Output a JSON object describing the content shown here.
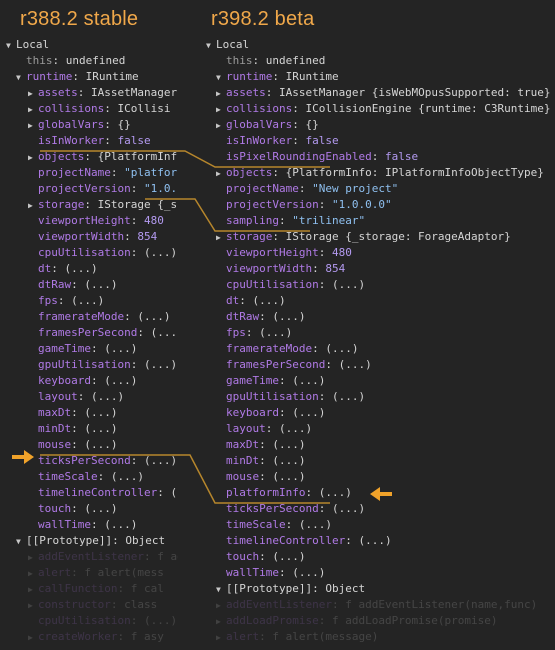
{
  "headers": {
    "stable": "r388.2 stable",
    "beta": "r398.2 beta"
  },
  "colors": {
    "accent": "#f0a84a",
    "background": "#242424"
  },
  "left": {
    "rows": [
      {
        "name": "local",
        "tri": "down",
        "key": "Local",
        "val": "",
        "keyClass": "label"
      },
      {
        "name": "this",
        "tri": "",
        "key": "this",
        "val": "undefined",
        "keyClass": "k dim",
        "valClass": "v-id"
      },
      {
        "name": "runtime",
        "tri": "down",
        "key": "runtime",
        "val": "IRuntime",
        "valClass": "v-id"
      },
      {
        "name": "assets",
        "tri": "right",
        "key": "assets",
        "val": "IAssetManager"
      },
      {
        "name": "collisions",
        "tri": "right",
        "key": "collisions",
        "val": "ICollisi"
      },
      {
        "name": "globalvars",
        "tri": "right",
        "key": "globalVars",
        "val": "{}"
      },
      {
        "name": "isinworker",
        "tri": "",
        "key": "isInWorker",
        "val": "false",
        "valClass": "v-bool"
      },
      {
        "name": "objects",
        "tri": "right",
        "key": "objects",
        "val": "{PlatformInf"
      },
      {
        "name": "projectname",
        "tri": "",
        "key": "projectName",
        "val": "\"platfor",
        "valClass": "v-str"
      },
      {
        "name": "projectversion",
        "tri": "",
        "key": "projectVersion",
        "val": "\"1.0.",
        "valClass": "v-str"
      },
      {
        "name": "storage",
        "tri": "right",
        "key": "storage",
        "val": "IStorage {_s"
      },
      {
        "name": "viewportheight",
        "tri": "",
        "key": "viewportHeight",
        "val": "480",
        "valClass": "v-num"
      },
      {
        "name": "viewportwidth",
        "tri": "",
        "key": "viewportWidth",
        "val": "854",
        "valClass": "v-num"
      },
      {
        "name": "cpuutilisation",
        "tri": "",
        "key": "cpuUtilisation",
        "val": "(...)"
      },
      {
        "name": "dt",
        "tri": "",
        "key": "dt",
        "val": "(...)"
      },
      {
        "name": "dtraw",
        "tri": "",
        "key": "dtRaw",
        "val": "(...)"
      },
      {
        "name": "fps",
        "tri": "",
        "key": "fps",
        "val": "(...)"
      },
      {
        "name": "frameratemode",
        "tri": "",
        "key": "framerateMode",
        "val": "(...)"
      },
      {
        "name": "framespersecond",
        "tri": "",
        "key": "framesPerSecond",
        "val": "(...)"
      },
      {
        "name": "gametime",
        "tri": "",
        "key": "gameTime",
        "val": "(...)"
      },
      {
        "name": "gpuutilisation",
        "tri": "",
        "key": "gpuUtilisation",
        "val": "(...)"
      },
      {
        "name": "keyboard",
        "tri": "",
        "key": "keyboard",
        "val": "(...)"
      },
      {
        "name": "layout",
        "tri": "",
        "key": "layout",
        "val": "(...)"
      },
      {
        "name": "maxdt",
        "tri": "",
        "key": "maxDt",
        "val": "(...)"
      },
      {
        "name": "mindt",
        "tri": "",
        "key": "minDt",
        "val": "(...)"
      },
      {
        "name": "mouse",
        "tri": "",
        "key": "mouse",
        "val": "(...)"
      },
      {
        "name": "tickspersecond",
        "tri": "",
        "key": "ticksPerSecond",
        "val": "(...)"
      },
      {
        "name": "timescale",
        "tri": "",
        "key": "timeScale",
        "val": "(...)"
      },
      {
        "name": "timelinecontroller",
        "tri": "",
        "key": "timelineController",
        "val": "("
      },
      {
        "name": "touch",
        "tri": "",
        "key": "touch",
        "val": "(...)"
      },
      {
        "name": "walltime",
        "tri": "",
        "key": "wallTime",
        "val": "(...)"
      },
      {
        "name": "prototype",
        "tri": "down",
        "key": "[[Prototype]]",
        "val": "Object",
        "keyClass": "label",
        "valClass": "v-id"
      },
      {
        "name": "proto-a",
        "tri": "right",
        "key": "addEventListener",
        "val": "f addEve",
        "faded": true
      },
      {
        "name": "proto-b",
        "tri": "right",
        "key": "alert",
        "val": "f alert(mess",
        "faded": true
      },
      {
        "name": "proto-c",
        "tri": "right",
        "key": "callFunction",
        "val": "f cal",
        "faded": true
      },
      {
        "name": "proto-d",
        "tri": "right",
        "key": "constructor",
        "val": "class",
        "faded": true
      },
      {
        "name": "proto-e",
        "tri": "",
        "key": "cpuUtilisation",
        "val": "(...)",
        "faded": true
      },
      {
        "name": "proto-f",
        "tri": "right",
        "key": "createWorker",
        "val": "f asy",
        "faded": true
      }
    ]
  },
  "right": {
    "rows": [
      {
        "name": "local",
        "tri": "down",
        "key": "Local",
        "val": "",
        "keyClass": "label"
      },
      {
        "name": "this",
        "tri": "",
        "key": "this",
        "val": "undefined",
        "keyClass": "k dim",
        "valClass": "v-id"
      },
      {
        "name": "runtime",
        "tri": "down",
        "key": "runtime",
        "val": "IRuntime",
        "valClass": "v-id"
      },
      {
        "name": "assets",
        "tri": "right",
        "key": "assets",
        "val": "IAssetManager {isWebMOpusSupported: true}"
      },
      {
        "name": "collisions",
        "tri": "right",
        "key": "collisions",
        "val": "ICollisionEngine {runtime: C3Runtime}"
      },
      {
        "name": "globalvars",
        "tri": "right",
        "key": "globalVars",
        "val": "{}"
      },
      {
        "name": "isinworker",
        "tri": "",
        "key": "isInWorker",
        "val": "false",
        "valClass": "v-bool"
      },
      {
        "name": "ispixelroundingenabled",
        "tri": "",
        "key": "isPixelRoundingEnabled",
        "val": "false",
        "valClass": "v-bool"
      },
      {
        "name": "objects",
        "tri": "right",
        "key": "objects",
        "val": "{PlatformInfo: IPlatformInfoObjectType}"
      },
      {
        "name": "projectname",
        "tri": "",
        "key": "projectName",
        "val": "\"New project\"",
        "valClass": "v-str"
      },
      {
        "name": "projectversion",
        "tri": "",
        "key": "projectVersion",
        "val": "\"1.0.0.0\"",
        "valClass": "v-str"
      },
      {
        "name": "sampling",
        "tri": "",
        "key": "sampling",
        "val": "\"trilinear\"",
        "valClass": "v-str"
      },
      {
        "name": "storage",
        "tri": "right",
        "key": "storage",
        "val": "IStorage {_storage: ForageAdaptor}"
      },
      {
        "name": "viewportheight",
        "tri": "",
        "key": "viewportHeight",
        "val": "480",
        "valClass": "v-num"
      },
      {
        "name": "viewportwidth",
        "tri": "",
        "key": "viewportWidth",
        "val": "854",
        "valClass": "v-num"
      },
      {
        "name": "cpuutilisation",
        "tri": "",
        "key": "cpuUtilisation",
        "val": "(...)"
      },
      {
        "name": "dt",
        "tri": "",
        "key": "dt",
        "val": "(...)"
      },
      {
        "name": "dtraw",
        "tri": "",
        "key": "dtRaw",
        "val": "(...)"
      },
      {
        "name": "fps",
        "tri": "",
        "key": "fps",
        "val": "(...)"
      },
      {
        "name": "frameratemode",
        "tri": "",
        "key": "framerateMode",
        "val": "(...)"
      },
      {
        "name": "framespersecond",
        "tri": "",
        "key": "framesPerSecond",
        "val": "(...)"
      },
      {
        "name": "gametime",
        "tri": "",
        "key": "gameTime",
        "val": "(...)"
      },
      {
        "name": "gpuutilisation",
        "tri": "",
        "key": "gpuUtilisation",
        "val": "(...)"
      },
      {
        "name": "keyboard",
        "tri": "",
        "key": "keyboard",
        "val": "(...)"
      },
      {
        "name": "layout",
        "tri": "",
        "key": "layout",
        "val": "(...)"
      },
      {
        "name": "maxdt",
        "tri": "",
        "key": "maxDt",
        "val": "(...)"
      },
      {
        "name": "mindt",
        "tri": "",
        "key": "minDt",
        "val": "(...)"
      },
      {
        "name": "mouse",
        "tri": "",
        "key": "mouse",
        "val": "(...)"
      },
      {
        "name": "platforminfo",
        "tri": "",
        "key": "platformInfo",
        "val": "(...)"
      },
      {
        "name": "tickspersecond",
        "tri": "",
        "key": "ticksPerSecond",
        "val": "(...)"
      },
      {
        "name": "timescale",
        "tri": "",
        "key": "timeScale",
        "val": "(...)"
      },
      {
        "name": "timelinecontroller",
        "tri": "",
        "key": "timelineController",
        "val": "(...)"
      },
      {
        "name": "touch",
        "tri": "",
        "key": "touch",
        "val": "(...)"
      },
      {
        "name": "walltime",
        "tri": "",
        "key": "wallTime",
        "val": "(...)"
      },
      {
        "name": "prototype",
        "tri": "down",
        "key": "[[Prototype]]",
        "val": "Object",
        "keyClass": "label",
        "valClass": "v-id"
      },
      {
        "name": "proto-a",
        "tri": "right",
        "key": "addEventListener",
        "val": "f addEventListener(name,func)",
        "faded": true
      },
      {
        "name": "proto-b",
        "tri": "right",
        "key": "addLoadPromise",
        "val": "f addLoadPromise(promise)",
        "faded": true
      },
      {
        "name": "proto-c",
        "tri": "right",
        "key": "alert",
        "val": "f alert(message)",
        "faded": true
      }
    ]
  }
}
